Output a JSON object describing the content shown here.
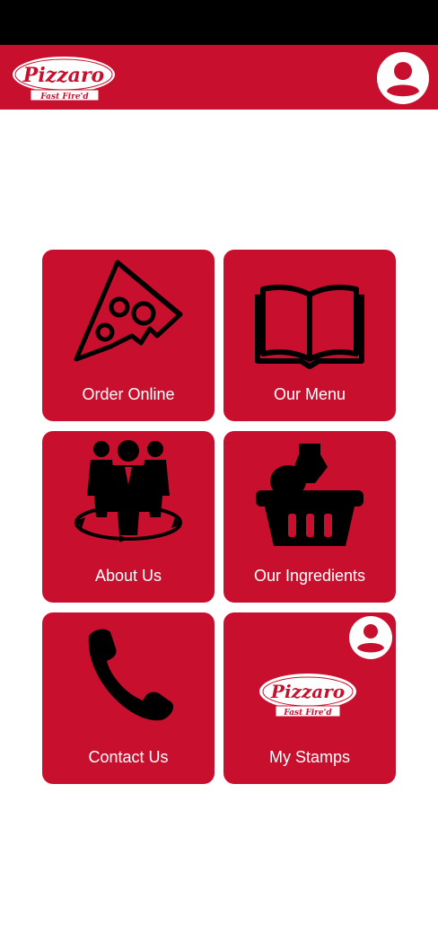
{
  "header": {
    "logo": {
      "brand": "Pizzaro",
      "tagline": "Fast Fire'd"
    },
    "profile_icon": "user-avatar-icon"
  },
  "tiles": [
    {
      "label": "Order Online",
      "icon": "pizza-slice-icon"
    },
    {
      "label": "Our Menu",
      "icon": "open-book-icon"
    },
    {
      "label": "About Us",
      "icon": "team-people-icon"
    },
    {
      "label": "Our Ingredients",
      "icon": "grocery-basket-icon"
    },
    {
      "label": "Contact Us",
      "icon": "phone-handset-icon"
    },
    {
      "label": "My Stamps",
      "icon": "pizzaro-logo",
      "badge_icon": "user-avatar-icon"
    }
  ],
  "colors": {
    "brand_red": "#c8102e",
    "status_bar": "#000000",
    "background": "#ffffff"
  }
}
